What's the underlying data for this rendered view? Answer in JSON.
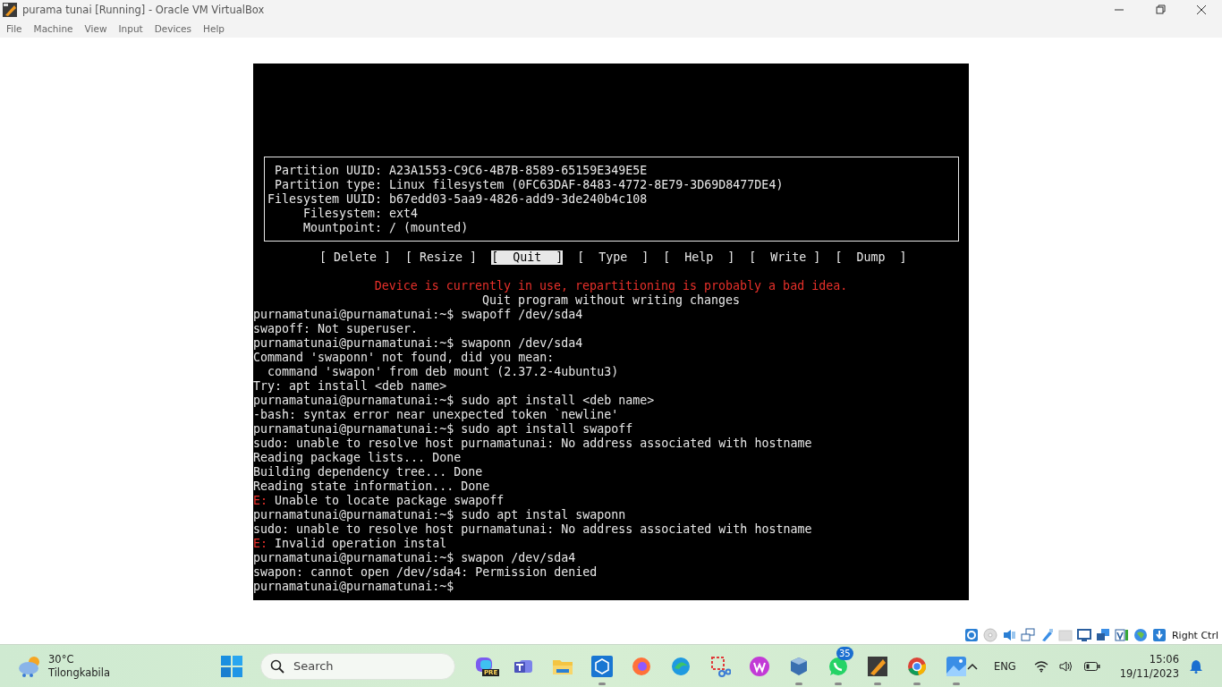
{
  "window": {
    "title": "purama tunai [Running] - Oracle VM VirtualBox"
  },
  "menu": [
    "File",
    "Machine",
    "View",
    "Input",
    "Devices",
    "Help"
  ],
  "console": {
    "partition_info": [
      {
        "label": "Partition UUID:",
        "value": "A23A1553-C9C6-4B7B-8589-65159E349E5E"
      },
      {
        "label": "Partition type:",
        "value": "Linux filesystem (0FC63DAF-8483-4772-8E79-3D69D8477DE4)"
      },
      {
        "label": "Filesystem UUID:",
        "value": "b67edd03-5aa9-4826-add9-3de240b4c108"
      },
      {
        "label": "Filesystem:",
        "value": "ext4"
      },
      {
        "label": "Mountpoint:",
        "value": "/ (mounted)"
      }
    ],
    "actions": [
      {
        "label": "[ Delete ]",
        "selected": false
      },
      {
        "label": "[ Resize ]",
        "selected": false
      },
      {
        "label": "[  Quit  ]",
        "selected": true
      },
      {
        "label": "[  Type  ]",
        "selected": false
      },
      {
        "label": "[  Help  ]",
        "selected": false
      },
      {
        "label": "[  Write ]",
        "selected": false
      },
      {
        "label": "[  Dump  ]",
        "selected": false
      }
    ],
    "warning": "Device is currently in use, repartitioning is probably a bad idea.",
    "hint": "Quit program without writing changes",
    "lines": [
      {
        "kind": "plain",
        "text": "purnamatunai@purnamatunai:~$ swapoff /dev/sda4"
      },
      {
        "kind": "plain",
        "text": "swapoff: Not superuser."
      },
      {
        "kind": "plain",
        "text": "purnamatunai@purnamatunai:~$ swaponn /dev/sda4"
      },
      {
        "kind": "plain",
        "text": "Command 'swaponn' not found, did you mean:"
      },
      {
        "kind": "plain",
        "text": "  command 'swapon' from deb mount (2.37.2-4ubuntu3)"
      },
      {
        "kind": "plain",
        "text": "Try: apt install <deb name>"
      },
      {
        "kind": "plain",
        "text": "purnamatunai@purnamatunai:~$ sudo apt install <deb name>"
      },
      {
        "kind": "plain",
        "text": "-bash: syntax error near unexpected token `newline'"
      },
      {
        "kind": "plain",
        "text": "purnamatunai@purnamatunai:~$ sudo apt install swapoff"
      },
      {
        "kind": "plain",
        "text": "sudo: unable to resolve host purnamatunai: No address associated with hostname"
      },
      {
        "kind": "plain",
        "text": "Reading package lists... Done"
      },
      {
        "kind": "plain",
        "text": "Building dependency tree... Done"
      },
      {
        "kind": "plain",
        "text": "Reading state information... Done"
      },
      {
        "kind": "error",
        "prefix": "E:",
        "text": "Unable to locate package swapoff"
      },
      {
        "kind": "plain",
        "text": "purnamatunai@purnamatunai:~$ sudo apt instal swaponn"
      },
      {
        "kind": "plain",
        "text": "sudo: unable to resolve host purnamatunai: No address associated with hostname"
      },
      {
        "kind": "error",
        "prefix": "E:",
        "text": "Invalid operation instal"
      },
      {
        "kind": "plain",
        "text": "purnamatunai@purnamatunai:~$ swapon /dev/sda4"
      },
      {
        "kind": "plain",
        "text": "swapon: cannot open /dev/sda4: Permission denied"
      },
      {
        "kind": "plain",
        "text": "purnamatunai@purnamatunai:~$"
      }
    ]
  },
  "status_bar": {
    "icons": [
      {
        "kind": "disk"
      },
      {
        "kind": "disc"
      },
      {
        "kind": "audio"
      },
      {
        "kind": "network"
      },
      {
        "kind": "usb"
      },
      {
        "kind": "shared"
      },
      {
        "kind": "display"
      },
      {
        "kind": "capture"
      },
      {
        "kind": "cpu"
      },
      {
        "kind": "globe"
      },
      {
        "kind": "download"
      }
    ],
    "host_key": "Right Ctrl"
  },
  "taskbar": {
    "weather": {
      "temperature": "30°C",
      "location": "Tilongkabila"
    },
    "search": {
      "placeholder": "Search"
    },
    "apps": [
      {
        "kind": "copilot",
        "label": "PRE",
        "running": false
      },
      {
        "kind": "teams",
        "running": false
      },
      {
        "kind": "folder",
        "running": false
      },
      {
        "kind": "cube",
        "running": true
      },
      {
        "kind": "firefox",
        "running": false
      },
      {
        "kind": "edge",
        "running": false
      },
      {
        "kind": "snip",
        "running": false
      },
      {
        "kind": "wps",
        "running": false
      },
      {
        "kind": "virtualbox",
        "running": true
      },
      {
        "kind": "whatsapp",
        "badge": "35",
        "running": true
      },
      {
        "kind": "orange",
        "running": true
      },
      {
        "kind": "chrome",
        "running": true
      },
      {
        "kind": "photos",
        "running": true
      }
    ],
    "language": "ENG",
    "time": "15:06",
    "date": "19/11/2023"
  }
}
